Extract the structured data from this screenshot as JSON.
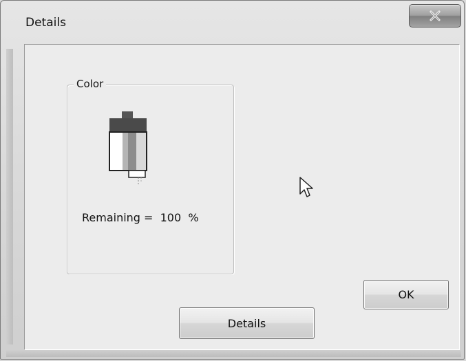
{
  "window": {
    "title": "Details",
    "close_label": "X"
  },
  "group": {
    "label": "Color",
    "remaining_text": "Remaining =  100  %",
    "remaining_percent": 100,
    "cartridge_icon": "ink-cartridge-icon"
  },
  "buttons": {
    "ok_label": "OK",
    "details_label": "Details"
  },
  "cursor_icon": "mouse-pointer-icon"
}
